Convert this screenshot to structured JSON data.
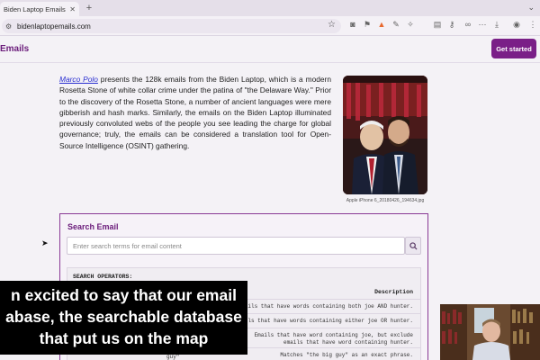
{
  "browser": {
    "tab_title": "Biden Laptop Emails - Biden",
    "url": "bidenlaptopemails.com"
  },
  "header": {
    "brand": "Emails",
    "cta_label": "Get started"
  },
  "intro": {
    "link_text": "Marco Polo",
    "body": " presents the 128k emails from the Biden Laptop, which is a modern Rosetta Stone of white collar crime under the patina of \"the Delaware Way.\" Prior to the discovery of the Rosetta Stone, a number of ancient languages were mere gibberish and hash marks. Similarly, the emails on the Biden Laptop illuminated previously convoluted webs of the people you see leading the charge for global governance; truly, the emails can be considered a translation tool for Open-Source Intelligence (OSINT) gathering."
  },
  "photo": {
    "caption": "Apple iPhone 6_20180426_194634.jpg"
  },
  "search": {
    "title": "Search Email",
    "placeholder": "Enter search terms for email content",
    "operators_heading": "SEARCH OPERATORS:",
    "description_header": "Description",
    "operators": [
      {
        "syntax": "",
        "description": "Emails that have words containing both joe AND hunter."
      },
      {
        "syntax": "",
        "description": "Emails that have words containing either joe OR hunter."
      },
      {
        "syntax": "",
        "description": "Emails that have word containing joe, but exclude emails that have word containing hunter."
      },
      {
        "syntax": "guy\"",
        "description": "Matches \"the big guy\" as an exact phrase."
      }
    ]
  },
  "subtitle": {
    "lines": [
      "n excited to say that our email",
      "abase, the searchable database",
      "that put us on the map"
    ]
  }
}
